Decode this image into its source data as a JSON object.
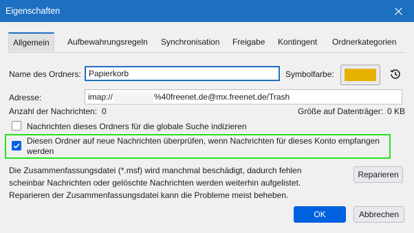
{
  "window": {
    "title": "Eigenschaften"
  },
  "tabs": [
    "Allgemein",
    "Aufbewahrungsregeln",
    "Synchronisation",
    "Freigabe",
    "Kontingent",
    "Ordnerkategorien"
  ],
  "folder": {
    "name_label": "Name des Ordners:",
    "name_value": "Papierkorb",
    "color_label": "Symbolfarbe:",
    "color_value": "#e7b103",
    "address_label": "Adresse:",
    "address_prefix": "imap://",
    "address_suffix": "%40freenet.de@mx.freenet.de/Trash",
    "message_count_label": "Anzahl der Nachrichten:",
    "message_count_value": "0",
    "disk_size_label": "Größe auf Datenträger:",
    "disk_size_value": "0 KB"
  },
  "options": {
    "global_search_label": "Nachrichten dieses Ordners für die globale Suche indizieren",
    "check_new_label": "Diesen Ordner auf neue Nachrichten überprüfen, wenn Nachrichten für dieses Konto empfangen werden"
  },
  "repair": {
    "info": "Die Zusammenfassungsdatei (*.msf) wird manchmal beschädigt, dadurch fehlen scheinbar Nachrichten oder gelöschte Nachrichten werden weiterhin aufgelistet. Reparieren der Zusammenfassungsdatei kann die Probleme meist beheben.",
    "button_label": "Reparieren"
  },
  "footer": {
    "ok_label": "OK",
    "cancel_label": "Abbrechen"
  }
}
